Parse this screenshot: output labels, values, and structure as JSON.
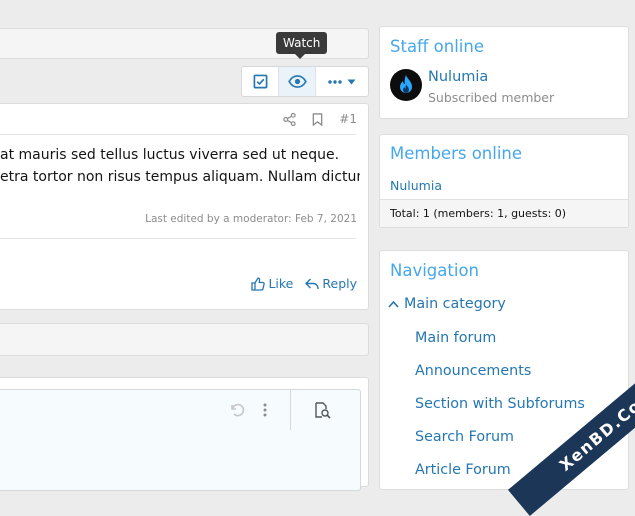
{
  "tooltip": "Watch",
  "toolbar": {
    "multiquote_icon": "check-square-icon",
    "watch_icon": "eye-icon",
    "more_icon": "ellipsis-icon"
  },
  "post": {
    "number": "#1",
    "lines": [
      "at mauris sed tellus luctus viverra sed ut neque.",
      "etra tortor non risus tempus aliquam. Nullam dictum"
    ],
    "last_edited": "Last edited by a moderator: Feb 7, 2021",
    "like_label": "Like",
    "reply_label": "Reply"
  },
  "staff_online": {
    "title": "Staff online",
    "member_name": "Nulumia",
    "member_title": "Subscribed member"
  },
  "members_online": {
    "title": "Members online",
    "member_name": "Nulumia",
    "footer": "Total: 1 (members: 1, guests: 0)"
  },
  "navigation": {
    "title": "Navigation",
    "category": "Main category",
    "links": [
      "Main forum",
      "Announcements",
      "Section with Subforums",
      "Search Forum",
      "Article Forum"
    ]
  },
  "watermark": "XenBD.Com",
  "colors": {
    "link": "#2577b1",
    "title": "#47a7eb",
    "watermark": "#1c3658"
  }
}
